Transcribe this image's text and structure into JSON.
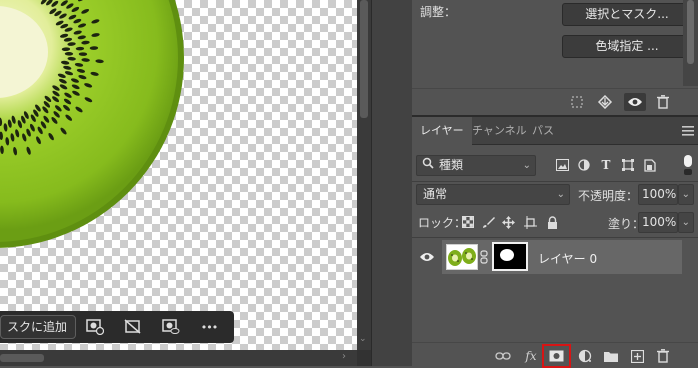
{
  "taskbar": {
    "add_mask_label": "スクに追加",
    "icons": [
      "mask-options-icon",
      "invert-mask-icon",
      "view-mask-icon",
      "more-icon"
    ],
    "more_label": "•••"
  },
  "properties": {
    "adjust_label": "調整：",
    "select_and_mask_button": "選択とマスク...",
    "color_range_button": "色域指定 ...",
    "footer_icons": [
      "load-selection-icon",
      "apply-mask-icon",
      "visibility-icon",
      "delete-icon"
    ]
  },
  "layers": {
    "tabs": [
      {
        "label": "レイヤー",
        "active": true
      },
      {
        "label": "チャンネル",
        "active": false
      },
      {
        "label": "パス",
        "active": false
      }
    ],
    "filter_kind": "種類",
    "filter_icons": [
      "pixel-filter-icon",
      "adjustment-filter-icon",
      "type-filter-icon",
      "shape-filter-icon",
      "smart-object-filter-icon"
    ],
    "blend_mode": "通常",
    "opacity_label": "不透明度：",
    "opacity_value": "100%",
    "lock_label": "ロック：",
    "lock_icons": [
      "lock-transparent-icon",
      "lock-image-icon",
      "lock-position-icon",
      "lock-artboard-icon",
      "lock-all-icon"
    ],
    "fill_label": "塗り：",
    "fill_value": "100%",
    "layer": {
      "name": "レイヤー 0",
      "visible": true,
      "selected": true
    },
    "footer_icons": [
      "link-layers-icon",
      "fx-icon",
      "add-mask-icon",
      "adjustment-layer-icon",
      "group-icon",
      "new-layer-icon",
      "delete-layer-icon"
    ],
    "fx_label": "fx"
  },
  "colors": {
    "panel": "#535353",
    "canvas_checker": "#cccccc",
    "highlight": "#d81414",
    "kiwi_green": "#8bbd1f"
  }
}
